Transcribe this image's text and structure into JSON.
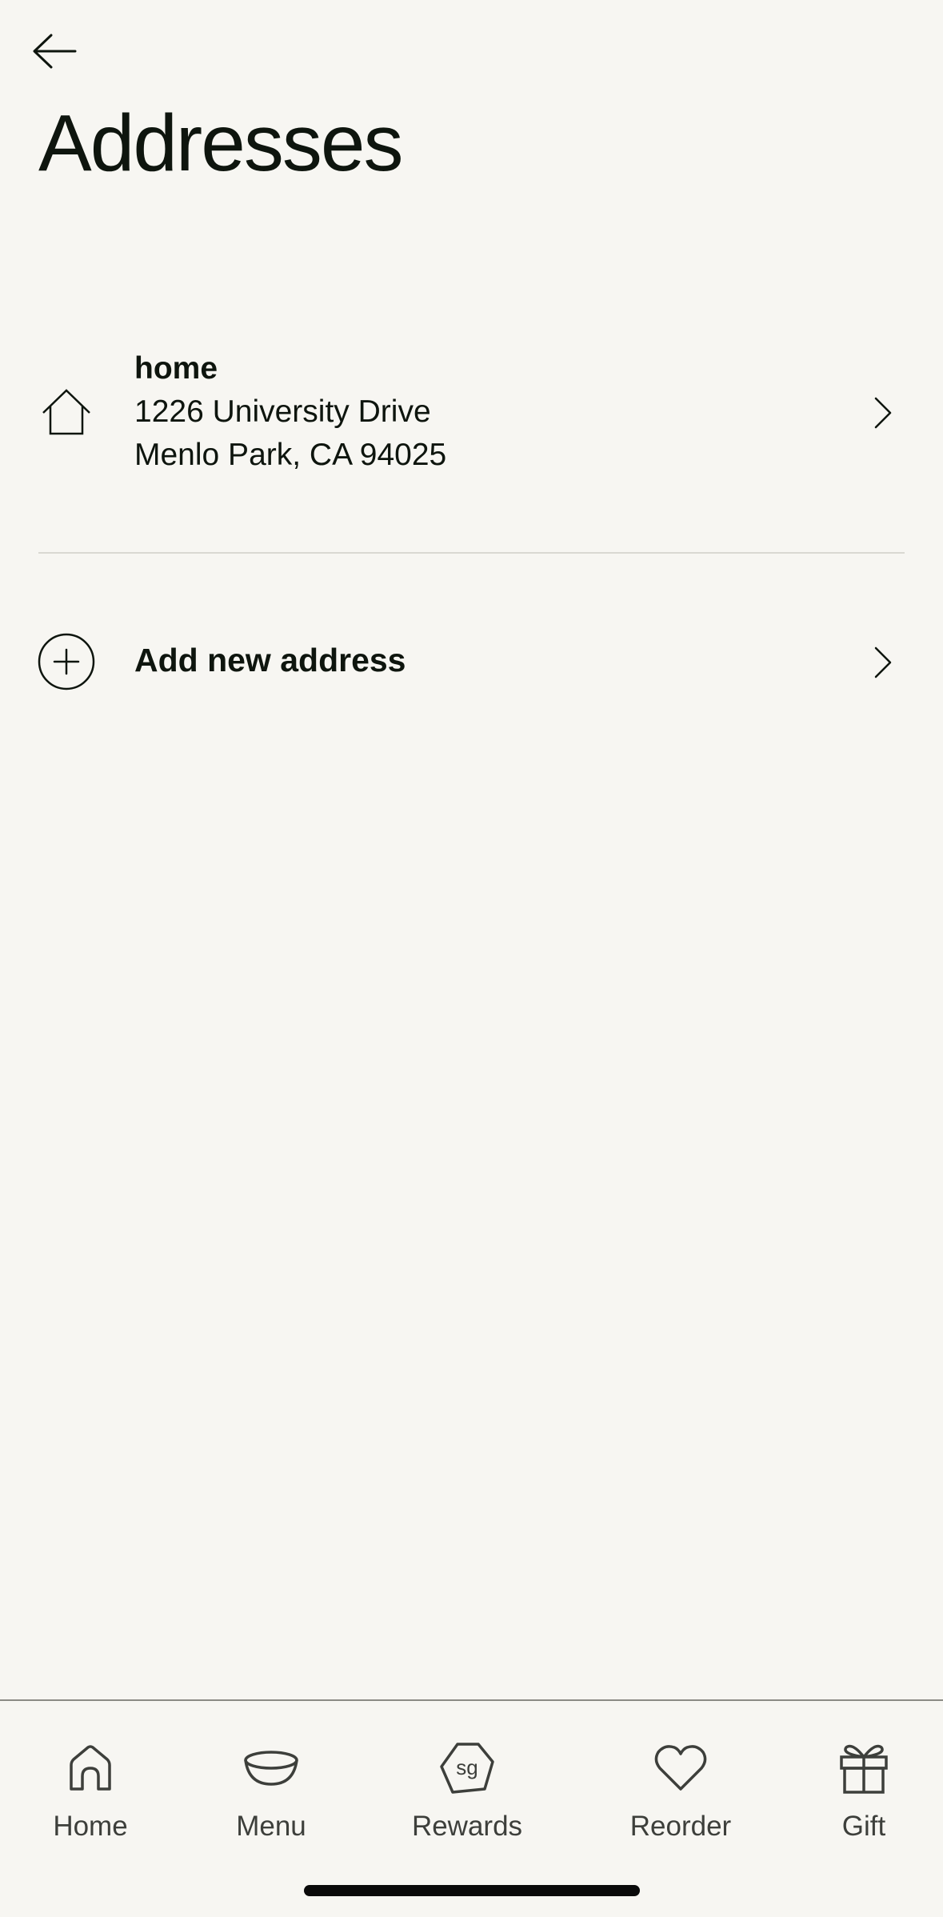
{
  "header": {
    "back_icon": "arrow-left-icon",
    "title": "Addresses"
  },
  "addresses": [
    {
      "icon": "house-icon",
      "label": "home",
      "line1": "1226 University Drive",
      "line2": "Menlo Park, CA 94025"
    }
  ],
  "add_address": {
    "icon": "plus-circle-icon",
    "label": "Add new address"
  },
  "bottom_nav": {
    "items": [
      {
        "label": "Home",
        "icon": "house-icon"
      },
      {
        "label": "Menu",
        "icon": "bowl-icon"
      },
      {
        "label": "Rewards",
        "icon": "sg-badge-icon",
        "badge_text": "sg"
      },
      {
        "label": "Reorder",
        "icon": "heart-icon"
      },
      {
        "label": "Gift",
        "icon": "gift-icon"
      }
    ]
  },
  "colors": {
    "background": "#f7f6f2",
    "text": "#0e150e",
    "nav_text": "#3d3f3b",
    "divider": "#d9d8d2"
  }
}
